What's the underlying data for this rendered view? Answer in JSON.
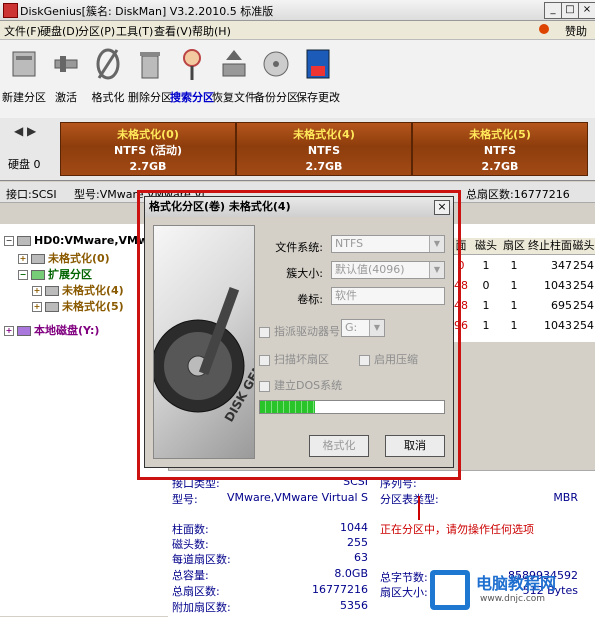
{
  "window": {
    "title": "DiskGenius[簇名: DiskMan] V3.2.2010.5 标准版",
    "controls": [
      "_",
      "□",
      "×"
    ]
  },
  "menu": {
    "items": [
      "文件(F)",
      "硬盘(D)",
      "分区(P)",
      "工具(T)",
      "查看(V)",
      "帮助(H)"
    ],
    "donate": "赞助"
  },
  "toolbar": {
    "buttons": [
      {
        "label": "新建分区",
        "icon": "new-partition-icon"
      },
      {
        "label": "激活",
        "icon": "activate-icon"
      },
      {
        "label": "格式化",
        "icon": "format-icon"
      },
      {
        "label": "删除分区",
        "icon": "delete-partition-icon"
      },
      {
        "label": "搜索分区",
        "icon": "search-partition-icon"
      },
      {
        "label": "恢复文件",
        "icon": "recover-files-icon"
      },
      {
        "label": "备份分区",
        "icon": "backup-partition-icon"
      },
      {
        "label": "保存更改",
        "icon": "save-changes-icon"
      }
    ]
  },
  "diskmap": {
    "nav": "◀ ▶",
    "disk_label": "硬盘 0",
    "partitions": [
      {
        "name": "未格式化(0)",
        "fs": "NTFS (活动)",
        "size": "2.7GB"
      },
      {
        "name": "未格式化(4)",
        "fs": "NTFS",
        "size": "2.7GB"
      },
      {
        "name": "未格式化(5)",
        "fs": "NTFS",
        "size": "2.7GB"
      }
    ]
  },
  "infoline": {
    "interface": "接口:SCSI",
    "model": "型号:VMware,VMware Vi",
    "total_sectors": "总扇区数:16777216"
  },
  "tree": {
    "disk": "HD0:VMware,VMware Virt",
    "items": [
      {
        "label": "未格式化(0)"
      },
      {
        "label": "扩展分区"
      },
      {
        "label": "未格式化(4)"
      },
      {
        "label": "未格式化(5)"
      }
    ],
    "local": "本地磁盘(Y:)"
  },
  "table": {
    "columns": [
      "面",
      "磁头",
      "扇区",
      "终止柱面",
      "磁头"
    ],
    "rows": [
      [
        "0",
        "1",
        "1",
        "347",
        "254"
      ],
      [
        "48",
        "0",
        "1",
        "1043",
        "254"
      ],
      [
        "48",
        "1",
        "1",
        "695",
        "254"
      ],
      [
        "96",
        "1",
        "1",
        "1043",
        "254"
      ]
    ]
  },
  "bottom": {
    "left_labels": [
      "接口类型:",
      "型号:",
      "柱面数:",
      "磁头数:",
      "每道扇区数:",
      "总容量:",
      "总扇区数:",
      "附加扇区数:"
    ],
    "left_values": [
      "SCSI",
      "VMware,VMware Virtual S",
      "1044",
      "255",
      "63",
      "8.0GB",
      "16777216",
      "5356"
    ],
    "right_labels": [
      "序列号:",
      "分区表类型:",
      "总字节数:",
      "扇区大小:"
    ],
    "right_values": [
      "",
      "MBR",
      "8589934592",
      "512 Bytes"
    ],
    "status": "正在分区中，请勿操作任何选项"
  },
  "dialog": {
    "title": "格式化分区(卷) 未格式化(4)",
    "close": "×",
    "image_text": "DISK GENIUS",
    "fields": [
      {
        "label": "文件系统:",
        "value": "NTFS"
      },
      {
        "label": "簇大小:",
        "value": "默认值(4096)"
      },
      {
        "label": "卷标:",
        "value": "软件"
      }
    ],
    "checkboxes": {
      "drive_letter": "指派驱动器号：",
      "drive_value": "G:",
      "scan_bad": "扫描坏扇区",
      "compress": "启用压缩",
      "dos": "建立DOS系统"
    },
    "progress": 0.3,
    "buttons": {
      "format": "格式化",
      "cancel": "取消"
    }
  },
  "watermark": {
    "title": "电脑教程网",
    "url": "www.dnjc.com"
  },
  "colors": {
    "partition": "#a5491a",
    "accent_red": "#cc1111",
    "progress": "#29c429"
  }
}
